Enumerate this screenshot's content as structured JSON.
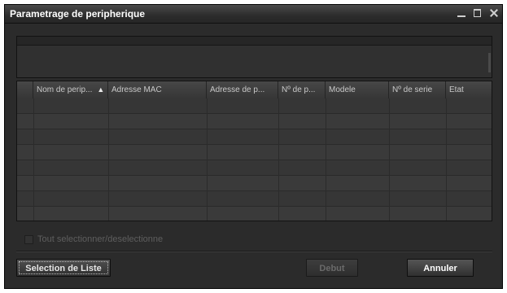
{
  "window": {
    "title": "Parametrage de peripherique",
    "controls": [
      "minimize-icon",
      "maximize-icon",
      "close-icon"
    ]
  },
  "table": {
    "columns": [
      "Nom de perip...",
      "Adresse MAC",
      "Adresse de p...",
      "Nº de p...",
      "Modele",
      "Nº de serie",
      "Etat"
    ],
    "sort_indicator": "▲",
    "sorted_column": 0,
    "rows": [
      [],
      [],
      [],
      [],
      [],
      [],
      [],
      []
    ]
  },
  "select_all": {
    "label": "Tout selectionner/deselectionne",
    "checked": false,
    "enabled": false
  },
  "buttons": {
    "list_selection": "Selection de Liste",
    "start": "Debut",
    "cancel": "Annuler"
  },
  "colors": {
    "background": "#2b2b2b",
    "title_text": "#ffffff",
    "disabled_text": "#6a6a6a"
  }
}
